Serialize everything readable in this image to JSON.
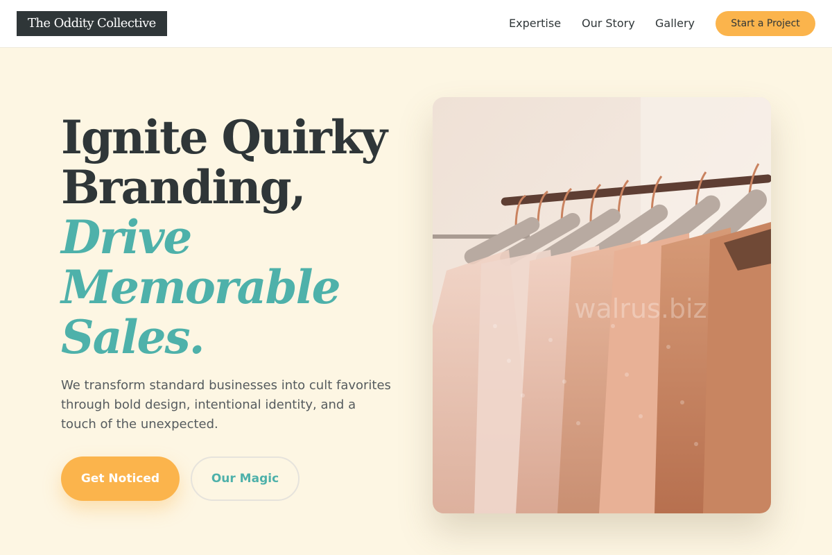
{
  "header": {
    "logo_text": "The Oddity Collective",
    "nav": [
      "Expertise",
      "Our Story",
      "Gallery"
    ],
    "cta_label": "Start a Project"
  },
  "hero": {
    "headline_lines": [
      "Ignite Quirky",
      "Branding,"
    ],
    "headline_accent_lines": [
      "Drive",
      "Memorable",
      "Sales."
    ],
    "subtext": "We transform standard businesses into cult favorites through bold design, intentional identity, and a touch of the unexpected.",
    "primary_button": "Get Noticed",
    "secondary_button": "Our Magic",
    "image_watermark": "walrus.biz"
  },
  "colors": {
    "background": "#fdf6e3",
    "header_bg": "#ffffff",
    "logo_bg": "#2f3638",
    "accent_orange": "#fbb44c",
    "accent_teal": "#4eb1aa",
    "text_dark": "#2f3638",
    "text_muted": "#555b5e"
  },
  "icons": {
    "hero_image": "clothing-rack-photo"
  }
}
